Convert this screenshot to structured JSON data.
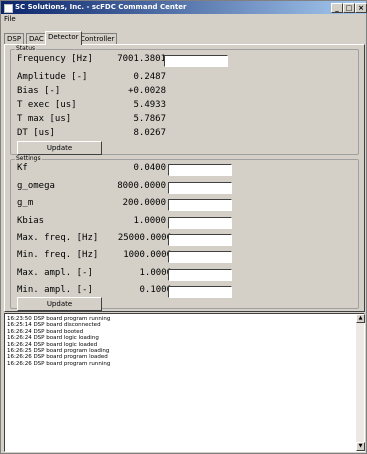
{
  "window": {
    "title": "SC Solutions, Inc. - scFDC Command Center",
    "minimize": "_",
    "maximize": "□",
    "close": "×"
  },
  "menu": {
    "file": "File"
  },
  "tabs": [
    "DSP",
    "DAC",
    "Detector",
    "Controller"
  ],
  "status": {
    "legend": "Status",
    "rows": [
      {
        "label": "Frequency [Hz]",
        "value": "7001.3801"
      },
      {
        "label": "Amplitude [-]",
        "value": "0.2487"
      },
      {
        "label": "Bias [-]",
        "value": "+0.0028"
      },
      {
        "label": "T exec [us]",
        "value": "5.4933"
      },
      {
        "label": "T max [us]",
        "value": "5.7867"
      },
      {
        "label": "DT [us]",
        "value": "8.0267"
      }
    ],
    "update_label": "Update"
  },
  "settings": {
    "legend": "Settings",
    "rows": [
      {
        "label": "Kf",
        "value": "0.0400"
      },
      {
        "label": "g_omega",
        "value": "8000.0000"
      },
      {
        "label": "g_m",
        "value": "200.0000"
      },
      {
        "label": "Kbias",
        "value": "1.0000"
      },
      {
        "label": "Max. freq. [Hz]",
        "value": "25000.0000"
      },
      {
        "label": "Min. freq. [Hz]",
        "value": "1000.0000"
      },
      {
        "label": "Max. ampl. [-]",
        "value": "1.0000"
      },
      {
        "label": "Min. ampl. [-]",
        "value": "0.1000"
      }
    ],
    "update_label": "Update"
  },
  "log": [
    "16:23:50 DSP board program running",
    "16:25:14 DSP board disconnected",
    "16:26:24 DSP board booted",
    "16:26:24 DSP board logic loading",
    "16:26:24 DSP board logic loaded",
    "16:26:25 DSP board program loading",
    "16:26:26 DSP board program loaded",
    "16:26:26 DSP board program running"
  ],
  "scrollbar": {
    "up": "▲",
    "down": "▼"
  }
}
